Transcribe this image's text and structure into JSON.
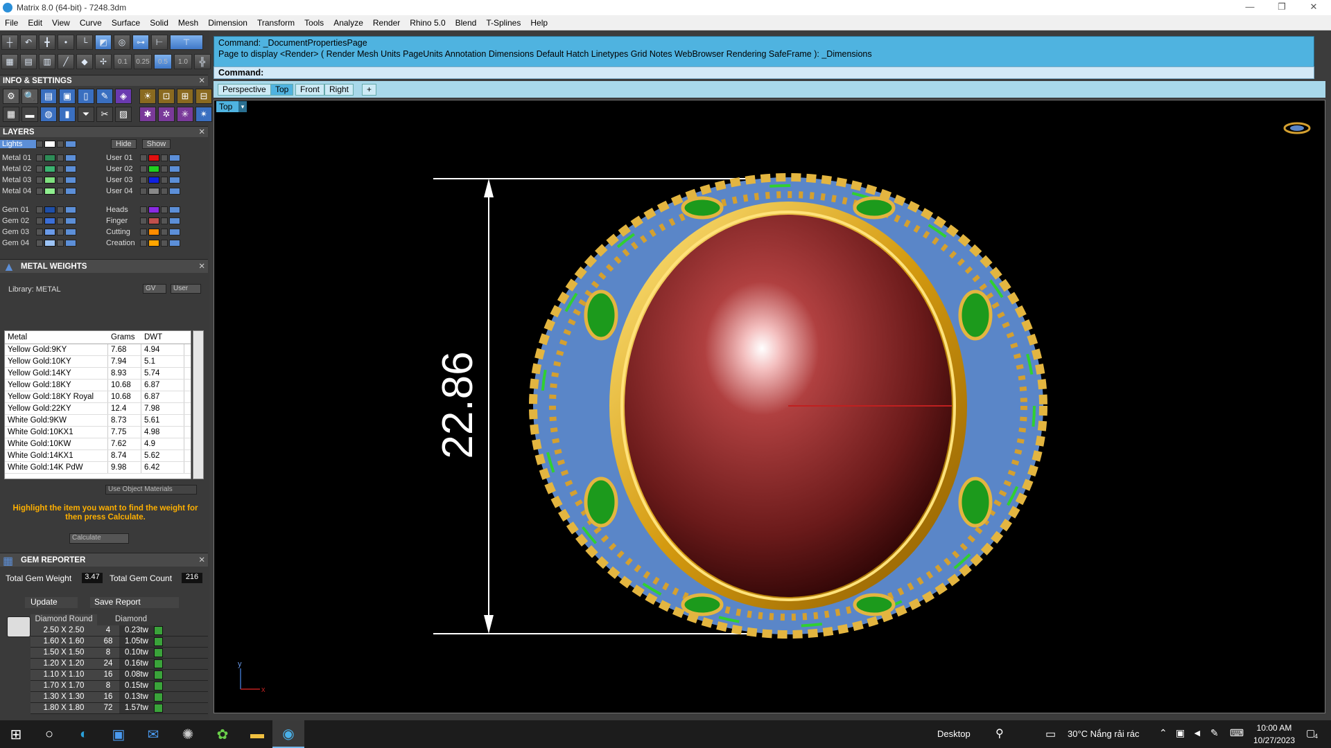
{
  "window": {
    "title": "Matrix 8.0 (64-bit) - 7248.3dm",
    "min_icon": "minimize-icon",
    "max_icon": "maximize-icon",
    "close_icon": "close-icon"
  },
  "menu": [
    "File",
    "Edit",
    "View",
    "Curve",
    "Surface",
    "Solid",
    "Mesh",
    "Dimension",
    "Transform",
    "Tools",
    "Analyze",
    "Render",
    "Rhino 5.0",
    "Blend",
    "T-Splines",
    "Help"
  ],
  "toolbar": {
    "values": [
      "0.1",
      "0.25",
      "0.5",
      "1.0"
    ]
  },
  "info_settings": {
    "title": "INFO & SETTINGS"
  },
  "layers": {
    "title": "LAYERS",
    "lights": "Lights",
    "hide": "Hide",
    "show": "Show",
    "left": [
      {
        "name": "Metal 01",
        "color": "#2e8b57"
      },
      {
        "name": "Metal 02",
        "color": "#3cb371"
      },
      {
        "name": "Metal 03",
        "color": "#7fe07f"
      },
      {
        "name": "Metal 04",
        "color": "#90ee90"
      },
      {
        "name": "Gem 01",
        "color": "#1f4fa8"
      },
      {
        "name": "Gem 02",
        "color": "#3b6fd8"
      },
      {
        "name": "Gem 03",
        "color": "#6a9ae8"
      },
      {
        "name": "Gem 04",
        "color": "#9cc3f5"
      }
    ],
    "right": [
      {
        "name": "User 01",
        "color": "#e01010"
      },
      {
        "name": "User 02",
        "color": "#20d020"
      },
      {
        "name": "User 03",
        "color": "#1020e0"
      },
      {
        "name": "User 04",
        "color": "#888888"
      },
      {
        "name": "Heads",
        "color": "#8a2be2"
      },
      {
        "name": "Finger",
        "color": "#c0504d"
      },
      {
        "name": "Cutting",
        "color": "#ff8c00"
      },
      {
        "name": "Creation",
        "color": "#ffa500"
      }
    ]
  },
  "metal_weights": {
    "title": "METAL WEIGHTS",
    "library": "Library: METAL",
    "gv": "GV",
    "user": "User",
    "headers": [
      "Metal",
      "Grams",
      "DWT"
    ],
    "rows": [
      [
        "Yellow Gold:9KY",
        "7.68",
        "4.94"
      ],
      [
        "Yellow Gold:10KY",
        "7.94",
        "5.1"
      ],
      [
        "Yellow Gold:14KY",
        "8.93",
        "5.74"
      ],
      [
        "Yellow Gold:18KY",
        "10.68",
        "6.87"
      ],
      [
        "Yellow Gold:18KY Royal",
        "10.68",
        "6.87"
      ],
      [
        "Yellow Gold:22KY",
        "12.4",
        "7.98"
      ],
      [
        "White Gold:9KW",
        "8.73",
        "5.61"
      ],
      [
        "White Gold:10KX1",
        "7.75",
        "4.98"
      ],
      [
        "White Gold:10KW",
        "7.62",
        "4.9"
      ],
      [
        "White Gold:14KX1",
        "8.74",
        "5.62"
      ],
      [
        "White Gold:14K PdW",
        "9.98",
        "6.42"
      ]
    ],
    "use_object_materials": "Use Object Materials",
    "hint": "Highlight the item you want to find the weight for then press Calculate.",
    "calculate": "Calculate"
  },
  "gem_reporter": {
    "title": "GEM REPORTER",
    "total_weight_label": "Total Gem Weight",
    "total_weight": "3.47",
    "total_count_label": "Total Gem Count",
    "total_count": "216",
    "update": "Update",
    "save_report": "Save Report",
    "headers": [
      "Diamond Round",
      "Diamond"
    ],
    "rows": [
      [
        "2.50 X 2.50",
        "4",
        "0.23tw"
      ],
      [
        "1.60 X 1.60",
        "68",
        "1.05tw"
      ],
      [
        "1.50 X 1.50",
        "8",
        "0.10tw"
      ],
      [
        "1.20 X 1.20",
        "24",
        "0.16tw"
      ],
      [
        "1.10 X 1.10",
        "16",
        "0.08tw"
      ],
      [
        "1.70 X 1.70",
        "8",
        "0.15tw"
      ],
      [
        "1.30 X 1.30",
        "16",
        "0.13tw"
      ],
      [
        "1.80 X 1.80",
        "72",
        "1.57tw"
      ]
    ]
  },
  "command": {
    "line1": "Command: _DocumentPropertiesPage",
    "line2": "Page to display <Render> ( Render  Mesh  Units  PageUnits  Annotation  Dimensions  Default  Hatch  Linetypes  Grid  Notes  WebBrowser  Rendering  SafeFrame ): _Dimensions",
    "prompt": "Command:"
  },
  "view_tabs": [
    "Perspective",
    "Top",
    "Front",
    "Right",
    "+"
  ],
  "viewport": {
    "label": "Top",
    "dimension": "22.86",
    "axis_y": "y",
    "axis_x": "x"
  },
  "taskbar": {
    "desktop": "Desktop",
    "weather": "30°C  Nắng rải rác",
    "time": "10:00 AM",
    "date": "10/27/2023",
    "notif": "4"
  }
}
